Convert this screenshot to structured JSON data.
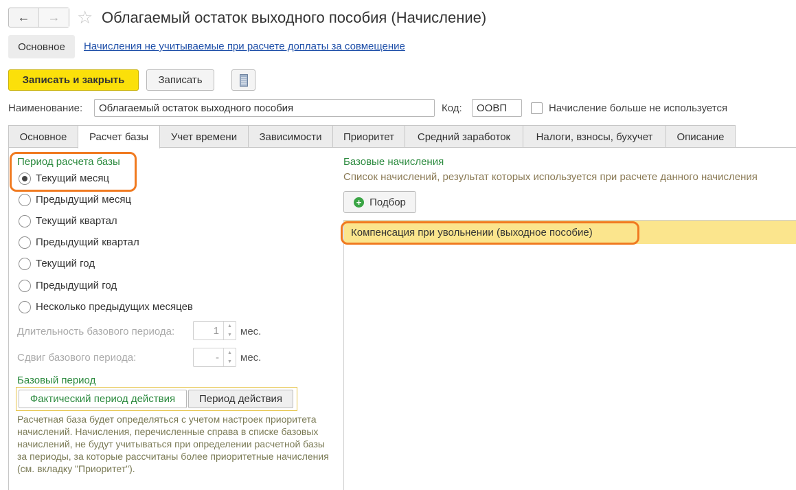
{
  "window": {
    "title": "Облагаемый остаток выходного пособия (Начисление)",
    "nav_back": "←",
    "nav_forward": "→",
    "star": "☆"
  },
  "subnav": {
    "main_label": "Основное",
    "link_label": "Начисления не учитываемые при расчете доплаты за совмещение"
  },
  "toolbar": {
    "save_close_label": "Записать и закрыть",
    "save_label": "Записать"
  },
  "form": {
    "name_label": "Наименование:",
    "name_value": "Облагаемый остаток выходного пособия",
    "code_label": "Код:",
    "code_value": "ООВП",
    "unused_label": "Начисление больше не используется"
  },
  "tabs": [
    {
      "label": "Основное"
    },
    {
      "label": "Расчет базы"
    },
    {
      "label": "Учет времени"
    },
    {
      "label": "Зависимости"
    },
    {
      "label": "Приоритет"
    },
    {
      "label": "Средний заработок"
    },
    {
      "label": "Налоги, взносы, бухучет"
    },
    {
      "label": "Описание"
    }
  ],
  "left": {
    "period_title": "Период расчета базы",
    "options": [
      {
        "label": "Текущий месяц",
        "selected": true
      },
      {
        "label": "Предыдущий месяц"
      },
      {
        "label": "Текущий квартал"
      },
      {
        "label": "Предыдущий квартал"
      },
      {
        "label": "Текущий год"
      },
      {
        "label": "Предыдущий год"
      },
      {
        "label": "Несколько предыдущих месяцев"
      }
    ],
    "duration_label": "Длительность базового периода:",
    "duration_value": "1",
    "duration_unit": "мес.",
    "shift_label": "Сдвиг базового периода:",
    "shift_value": "-",
    "shift_unit": "мес.",
    "base_period_title": "Базовый период",
    "seg_actual": "Фактический период действия",
    "seg_period": "Период действия",
    "description": "Расчетная база будет определяться с учетом настроек приоритета начислений. Начисления, перечисленные справа в списке базовых начислений, не будут учитываться при определении расчетной базы за периоды, за которые рассчитаны более приоритетные начисления (см. вкладку \"Приоритет\")."
  },
  "right": {
    "base_title": "Базовые начисления",
    "base_desc": "Список начислений, результат которых используется при расчете данного начисления",
    "podbor_label": "Подбор",
    "items": [
      {
        "label": "Компенсация при увольнении (выходное пособие)"
      }
    ]
  },
  "colors": {
    "accent_yellow": "#fbe00a",
    "section_green": "#2b8a3e",
    "highlight_orange": "#f07a20",
    "row_selected": "#fbe58d"
  }
}
